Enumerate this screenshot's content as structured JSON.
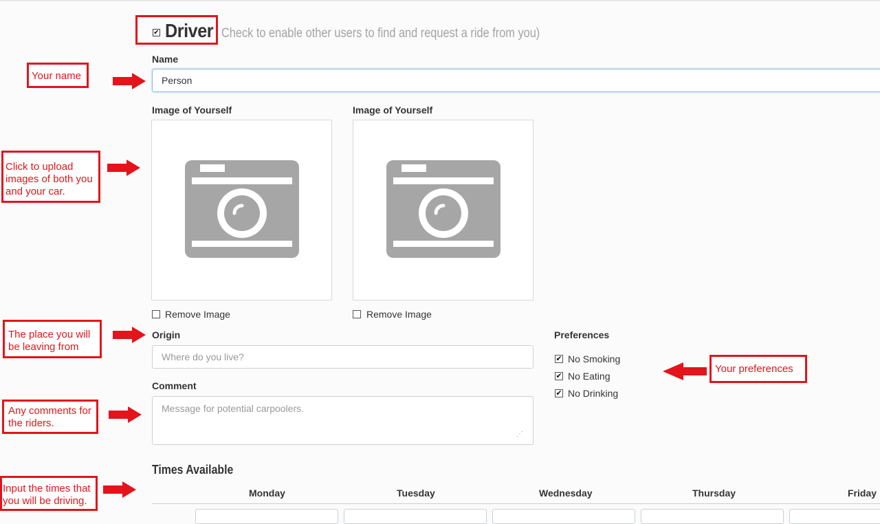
{
  "driver": {
    "checkbox_mark": "✔",
    "title": "Driver",
    "hint": "Check to enable other users to find and request a ride from you)"
  },
  "name": {
    "label": "Name",
    "value": "Person"
  },
  "images": [
    {
      "label": "Image of Yourself",
      "remove_label": "Remove Image"
    },
    {
      "label": "Image of Yourself",
      "remove_label": "Remove Image"
    }
  ],
  "origin": {
    "label": "Origin",
    "placeholder": "Where do you live?"
  },
  "comment": {
    "label": "Comment",
    "placeholder": "Message for potential carpoolers."
  },
  "preferences": {
    "label": "Preferences",
    "items": [
      {
        "label": "No Smoking",
        "checked": true
      },
      {
        "label": "No Eating",
        "checked": true
      },
      {
        "label": "No Drinking",
        "checked": true
      }
    ]
  },
  "times": {
    "heading": "Times Available",
    "days": [
      "Monday",
      "Tuesday",
      "Wednesday",
      "Thursday",
      "Friday"
    ]
  },
  "annotations": {
    "your_name": "Your name",
    "upload": "Click to upload images of both you and your car.",
    "origin": "The place you will be leaving from",
    "comments": "Any comments for the riders.",
    "times": "Input the times that you will be driving.",
    "preferences": "Your preferences"
  },
  "colors": {
    "annotation": "#e3141b",
    "camera_icon": "#a6a6a6"
  },
  "icons": {
    "image_placeholder": "camera-icon",
    "annotation_pointer": "arrow-right-icon"
  }
}
